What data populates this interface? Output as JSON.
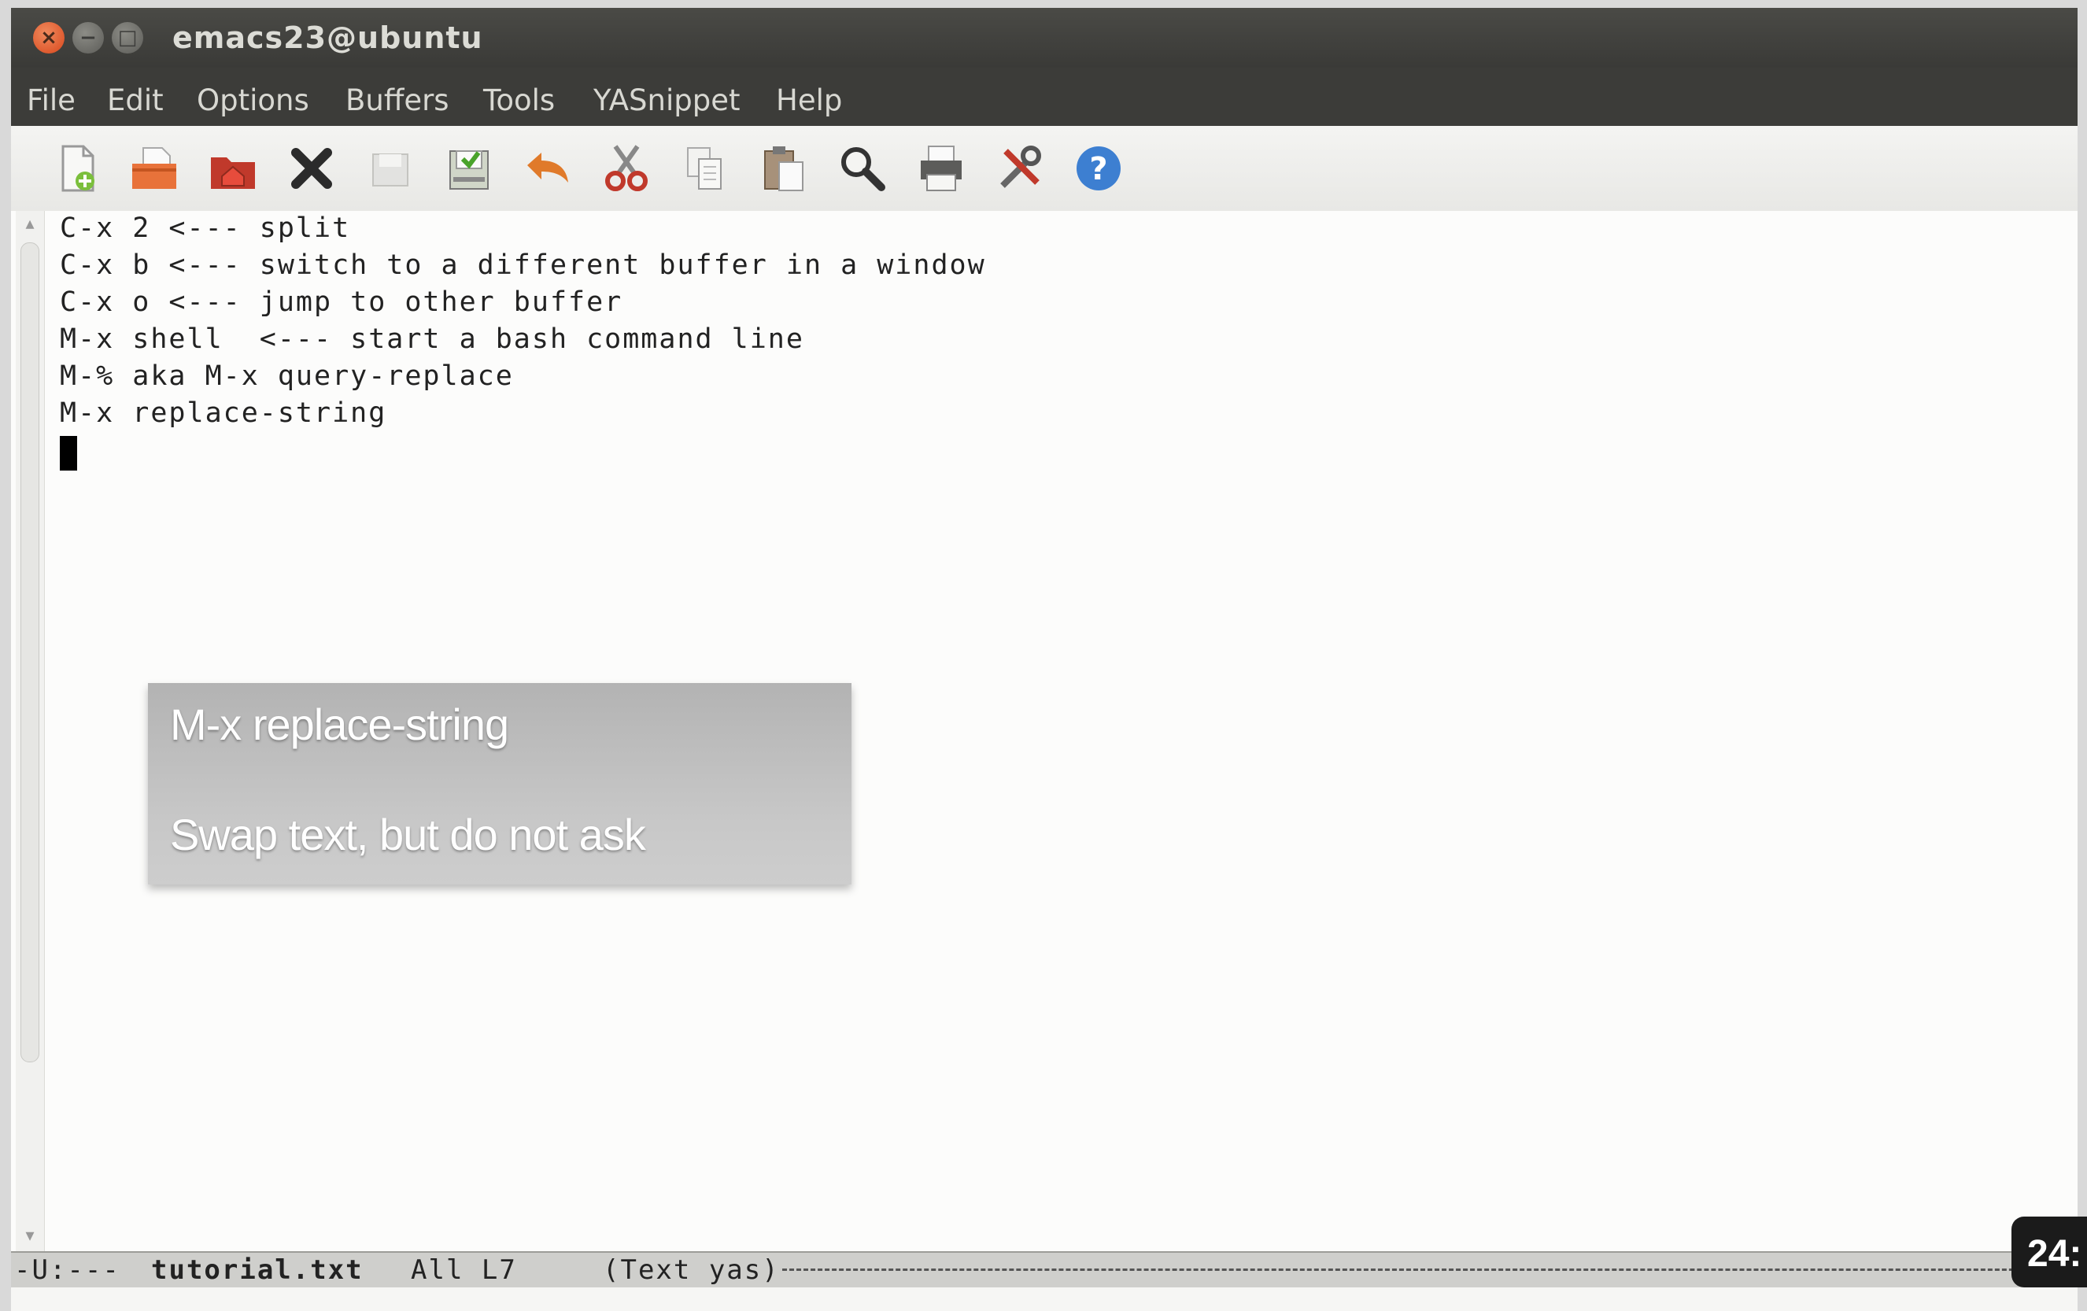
{
  "window": {
    "title": "emacs23@ubuntu",
    "buttons": {
      "close": "×",
      "minimize": "−",
      "maximize": "□"
    }
  },
  "menu": [
    "File",
    "Edit",
    "Options",
    "Buffers",
    "Tools",
    "YASnippet",
    "Help"
  ],
  "toolbar": {
    "icons": [
      "new-file-icon",
      "open-file-icon",
      "open-directory-icon",
      "close-buffer-icon",
      "save-icon",
      "save-as-icon",
      "undo-icon",
      "cut-icon",
      "copy-icon",
      "paste-icon",
      "search-icon",
      "print-icon",
      "preferences-icon",
      "help-icon"
    ],
    "colors": {
      "undo": "#e07a2a",
      "help": "#3d7fd1",
      "close": "#2b2b2b"
    }
  },
  "editor": {
    "lines": [
      "C-x 2 <--- split",
      "C-x b <--- switch to a different buffer in a window",
      "C-x o <--- jump to other buffer",
      "M-x shell  <--- start a bash command line",
      "M-% aka M-x query-replace",
      "M-x replace-string"
    ]
  },
  "caption": {
    "title": "M-x replace-string",
    "subtitle": "Swap text, but do not ask"
  },
  "modeline": {
    "status": "-U:---",
    "buffer": "tutorial.txt",
    "position": "All L7",
    "modes": "(Text yas)"
  },
  "badge": {
    "text": "24:"
  }
}
